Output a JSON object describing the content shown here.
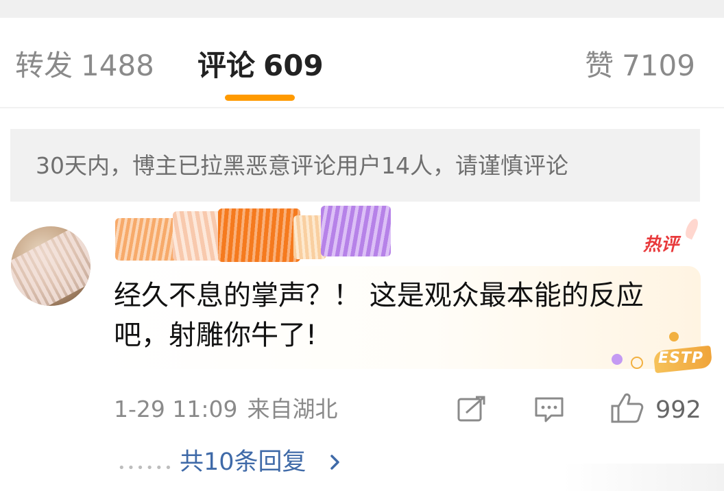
{
  "tabs": {
    "repost": {
      "label": "转发",
      "count": "1488"
    },
    "comments": {
      "label": "评论",
      "count": "609"
    },
    "likes": {
      "label": "赞",
      "count": "7109"
    }
  },
  "notice": {
    "text": "30天内，博主已拉黑恶意评论用户14人，请谨慎评论"
  },
  "comment": {
    "badge": "热评",
    "text": "经久不息的掌声？！ 这是观众最本能的反应吧，射雕你牛了!",
    "mbti_tag": "ESTP",
    "time": "1-29 11:09",
    "location": "来自湖北",
    "like_count": "992",
    "replies_label": "共10条回复"
  },
  "colors": {
    "accent": "#ff9a00",
    "hot_badge": "#e8393b",
    "link": "#3f6aa8",
    "muted_text": "#8a8a8a"
  },
  "icons": [
    "share-icon",
    "comment-icon",
    "like-icon",
    "chevron-right-icon"
  ]
}
